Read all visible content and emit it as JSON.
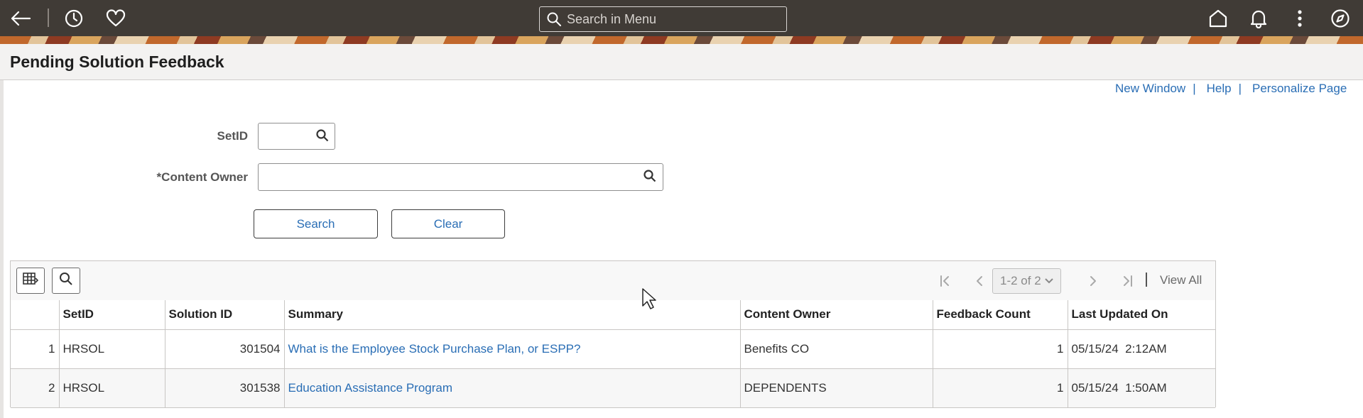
{
  "header": {
    "search_placeholder": "Search in Menu",
    "icons": [
      "back-arrow-icon",
      "history-icon",
      "favorites-heart-icon",
      "search-icon",
      "home-icon",
      "notifications-bell-icon",
      "actions-menu-icon",
      "navbar-compass-icon"
    ]
  },
  "page": {
    "title": "Pending Solution Feedback",
    "links": {
      "new_window": "New Window",
      "sep1": "|",
      "help": "Help",
      "sep2": "|",
      "personalize": "Personalize Page"
    }
  },
  "form": {
    "setid_label": "SetID",
    "setid_value": "",
    "content_owner_label": "*Content Owner",
    "content_owner_value": "",
    "search_button": "Search",
    "clear_button": "Clear"
  },
  "grid": {
    "pager_text": "1-2 of 2",
    "view_all": "View All",
    "columns": [
      "",
      "SetID",
      "Solution ID",
      "Summary",
      "Content Owner",
      "Feedback Count",
      "Last Updated On"
    ],
    "rows": [
      {
        "num": "1",
        "setid": "HRSOL",
        "solution_id": "301504",
        "summary": "What is the Employee Stock Purchase Plan, or ESPP?",
        "owner": "Benefits CO",
        "count": "1",
        "updated": "05/15/24  2:12AM"
      },
      {
        "num": "2",
        "setid": "HRSOL",
        "solution_id": "301538",
        "summary": "Education Assistance Program",
        "owner": "DEPENDENTS",
        "count": "1",
        "updated": "05/15/24  1:50AM"
      }
    ]
  },
  "colors": {
    "header_bg": "#403b36",
    "link": "#2a6eb5",
    "title_bar": "#f3f2f1"
  }
}
